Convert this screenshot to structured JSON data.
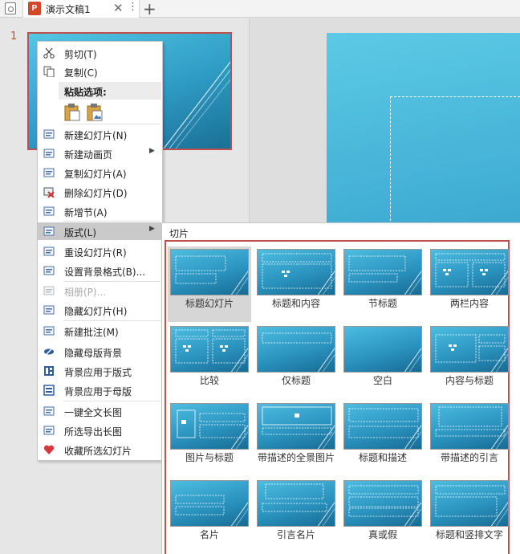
{
  "tab": {
    "logo_text": "P",
    "title": "演示文稿1",
    "close_glyph": "✕",
    "more_glyph": "⋮",
    "add_glyph": "+"
  },
  "slide_panel": {
    "slide_number": "1"
  },
  "context_menu": {
    "items": [
      {
        "label": "剪切(T)",
        "icon": "scissors-icon"
      },
      {
        "label": "复制(C)",
        "icon": "copy-icon"
      },
      {
        "label": "粘贴选项:",
        "icon": "clipboard-icon"
      },
      {
        "label": "新建幻灯片(N)",
        "icon": "new-slide-icon"
      },
      {
        "label": "新建动画页",
        "icon": "animation-page-icon"
      },
      {
        "label": "复制幻灯片(A)",
        "icon": "duplicate-slide-icon"
      },
      {
        "label": "删除幻灯片(D)",
        "icon": "delete-slide-icon"
      },
      {
        "label": "新增节(A)",
        "icon": "new-section-icon"
      },
      {
        "label": "版式(L)",
        "icon": "layout-icon"
      },
      {
        "label": "重设幻灯片(R)",
        "icon": "reset-slide-icon"
      },
      {
        "label": "设置背景格式(B)...",
        "icon": "background-format-icon"
      },
      {
        "label": "相册(P)...",
        "icon": "album-icon"
      },
      {
        "label": "隐藏幻灯片(H)",
        "icon": "hide-slide-icon"
      },
      {
        "label": "新建批注(M)",
        "icon": "comment-icon"
      },
      {
        "label": "隐藏母版背景",
        "icon": "hide-master-icon"
      },
      {
        "label": "背景应用于版式",
        "icon": "apply-layout-icon"
      },
      {
        "label": "背景应用于母版",
        "icon": "apply-master-icon"
      },
      {
        "label": "一键全文长图",
        "icon": "long-image-icon"
      },
      {
        "label": "所选导出长图",
        "icon": "export-image-icon"
      },
      {
        "label": "收藏所选幻灯片",
        "icon": "favorite-icon"
      }
    ],
    "submenu_arrow": "▶"
  },
  "layout_gallery": {
    "section_title": "切片",
    "layouts": [
      {
        "label": "标题幻灯片",
        "selected": true
      },
      {
        "label": "标题和内容",
        "selected": false
      },
      {
        "label": "节标题",
        "selected": false
      },
      {
        "label": "两栏内容",
        "selected": false
      },
      {
        "label": "比较",
        "selected": false
      },
      {
        "label": "仅标题",
        "selected": false
      },
      {
        "label": "空白",
        "selected": false
      },
      {
        "label": "内容与标题",
        "selected": false
      },
      {
        "label": "图片与标题",
        "selected": false
      },
      {
        "label": "带描述的全景图片",
        "selected": false
      },
      {
        "label": "标题和描述",
        "selected": false
      },
      {
        "label": "带描述的引言",
        "selected": false
      },
      {
        "label": "名片",
        "selected": false
      },
      {
        "label": "引言名片",
        "selected": false
      },
      {
        "label": "真或假",
        "selected": false
      },
      {
        "label": "标题和竖排文字",
        "selected": false
      }
    ]
  },
  "colors": {
    "accent_red": "#c0504d",
    "slide_blue": "#2f9cc5",
    "menu_highlight": "#c9c9c9"
  }
}
